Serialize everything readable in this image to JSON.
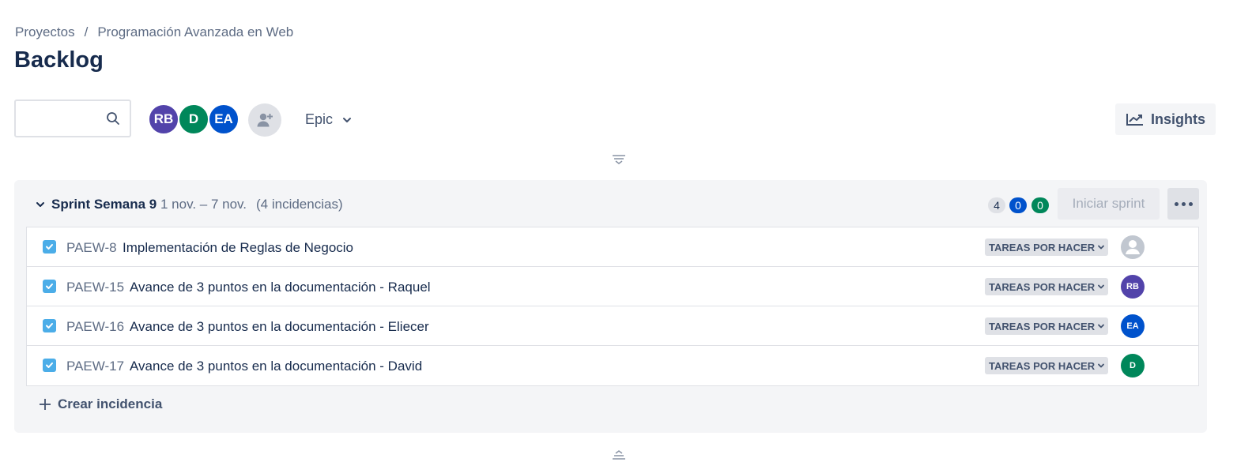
{
  "breadcrumb": {
    "items": [
      "Proyectos",
      "Programación Avanzada en Web"
    ],
    "separator": "/"
  },
  "page": {
    "title": "Backlog"
  },
  "toolbar": {
    "search_placeholder": "",
    "avatars": [
      {
        "initials": "RB",
        "color": "#5243aa"
      },
      {
        "initials": "D",
        "color": "#00875a"
      },
      {
        "initials": "EA",
        "color": "#0052cc"
      }
    ],
    "epic_filter_label": "Epic",
    "insights_label": "Insights"
  },
  "sprint": {
    "name": "Sprint Semana 9",
    "dates": "1 nov. – 7 nov.",
    "issue_count": "(4 incidencias)",
    "counts": {
      "todo": "4",
      "in_progress": "0",
      "done": "0"
    },
    "start_label": "Iniciar sprint",
    "issues": [
      {
        "key": "PAEW-8",
        "summary": "Implementación de Reglas de Negocio",
        "status": "TAREAS POR HACER",
        "assignee": ""
      },
      {
        "key": "PAEW-15",
        "summary": "Avance de 3 puntos en la documentación - Raquel",
        "status": "TAREAS POR HACER",
        "assignee": "RB"
      },
      {
        "key": "PAEW-16",
        "summary": "Avance de 3 puntos en la documentación - Eliecer",
        "status": "TAREAS POR HACER",
        "assignee": "EA"
      },
      {
        "key": "PAEW-17",
        "summary": "Avance de 3 puntos en la documentación - David",
        "status": "TAREAS POR HACER",
        "assignee": "D"
      }
    ],
    "create_label": "Crear incidencia"
  },
  "colors": {
    "status_todo": "#dfe1e6",
    "status_in_progress": "#0052cc",
    "status_done": "#00875a",
    "task_icon": "#4bade8"
  }
}
